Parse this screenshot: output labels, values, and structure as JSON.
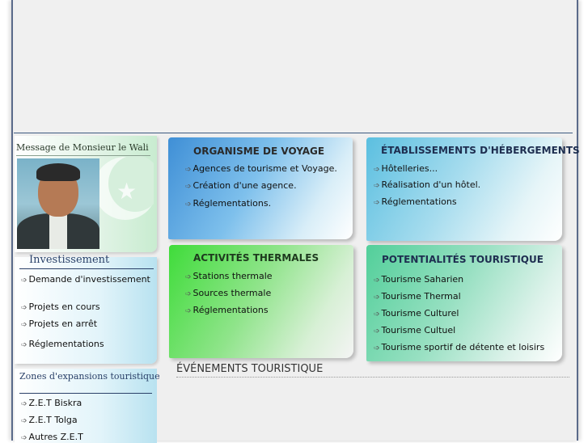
{
  "wali": {
    "title": "Message de  Monsieur le Wali"
  },
  "investissement": {
    "title": "Investissement",
    "items": [
      "Demande d'investissement",
      "Projets en cours",
      "Projets en arrêt",
      "Réglementations"
    ]
  },
  "zones": {
    "title": "Zones d'expansions touristique",
    "items": [
      "Z.E.T Biskra",
      "Z.E.T Tolga",
      "Autres Z.E.T"
    ]
  },
  "cards": {
    "voyage": {
      "title": "ORGANISME DE VOYAGE",
      "color": "#2a2a2a",
      "items": [
        "Agences de tourisme et Voyage.",
        "Création d'une agence.",
        "Réglementations."
      ]
    },
    "hebergement": {
      "title": "ÉTABLISSEMENTS D'HÉBERGEMENTS",
      "color": "#1e2e50",
      "items": [
        "Hôtelleries...",
        "Réalisation d'un hôtel.",
        "Réglementations"
      ]
    },
    "thermal": {
      "title": "ACTIVITÉS THERMALES",
      "color": "#1e3a1e",
      "items": [
        "Stations  thermale",
        "Sources thermale",
        "Réglementations"
      ]
    },
    "potentialites": {
      "title": "POTENTIALITÉS TOURISTIQUE",
      "color": "#1e2e50",
      "items": [
        "Tourisme Saharien",
        "Tourisme Thermal",
        "Tourisme Culturel",
        "Tourisme Cultuel",
        "Tourisme sportif de détente et loisirs"
      ]
    }
  },
  "events": {
    "title": "ÉVÉNEMENTS TOURISTIQUE"
  },
  "arrow_glyph": "➩"
}
